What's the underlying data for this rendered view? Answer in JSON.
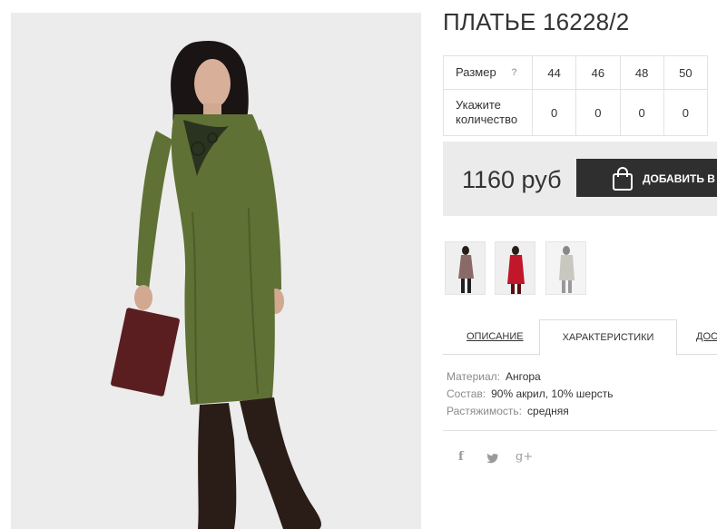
{
  "product": {
    "title": "ПЛАТЬЕ 16228/2",
    "price": "1160 руб",
    "add_to_cart_label": "ДОБАВИТЬ В ЗАКАЗ"
  },
  "size_table": {
    "size_label": "Размер",
    "help_symbol": "?",
    "quantity_label": "Укажите количество",
    "sizes": [
      "44",
      "46",
      "48",
      "50"
    ],
    "quantities": [
      "0",
      "0",
      "0",
      "0"
    ]
  },
  "tabs": [
    {
      "label": "ОПИСАНИЕ"
    },
    {
      "label": "ХАРАКТЕРИСТИКИ"
    },
    {
      "label": "ДОСТАВКА"
    }
  ],
  "specs": [
    {
      "key": "Материал:",
      "value": "Ангора"
    },
    {
      "key": "Состав:",
      "value": "90% акрил, 10% шерсть"
    },
    {
      "key": "Растяжимость:",
      "value": "средняя"
    }
  ],
  "social": [
    {
      "icon": "facebook-icon",
      "glyph": "f"
    },
    {
      "icon": "twitter-icon",
      "glyph": "t"
    },
    {
      "icon": "google-plus-icon",
      "glyph": "g+"
    }
  ],
  "colors": {
    "dress_main": "#5f7134",
    "dress_thumb_1": "#8a6a68",
    "dress_thumb_2": "#c0172a",
    "dress_thumb_3": "#c8c8c0",
    "button_bg": "#2f2f2f",
    "price_bg": "#ebebeb"
  }
}
